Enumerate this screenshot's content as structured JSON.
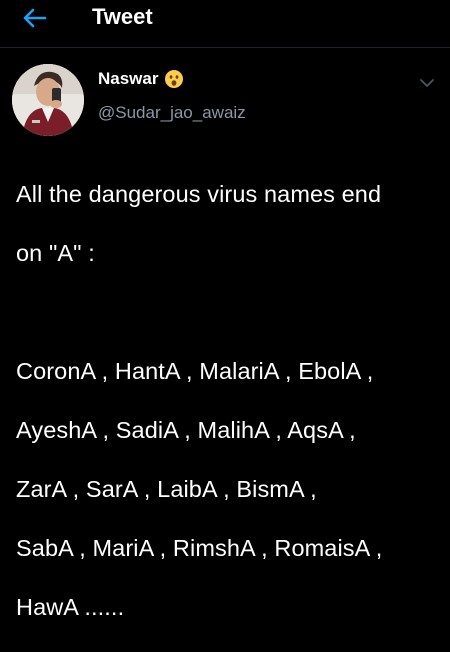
{
  "header": {
    "title": "Tweet",
    "back_icon": "arrow-left-icon",
    "accent_color": "#1da1f2"
  },
  "tweet": {
    "author": {
      "display_name": "Naswar",
      "name_emoji": "astonished-face-emoji",
      "handle": "@Sudar_jao_awaiz"
    },
    "more_icon": "chevron-down-icon",
    "text_lines": [
      "All the dangerous virus names end",
      "on \"A\" :",
      "",
      "CoronA , HantA , MalariA , EbolA ,",
      "AyeshA , SadiA , MalihA , AqsA ,",
      "ZarA , SarA , LaibA , BismA ,",
      "SabA , MariA , RimshA , RomaisA ,",
      "HawA ......"
    ]
  },
  "colors": {
    "background": "#000000",
    "text": "#ffffff",
    "secondary_text": "#8b98a5",
    "divider": "#1f2328"
  }
}
